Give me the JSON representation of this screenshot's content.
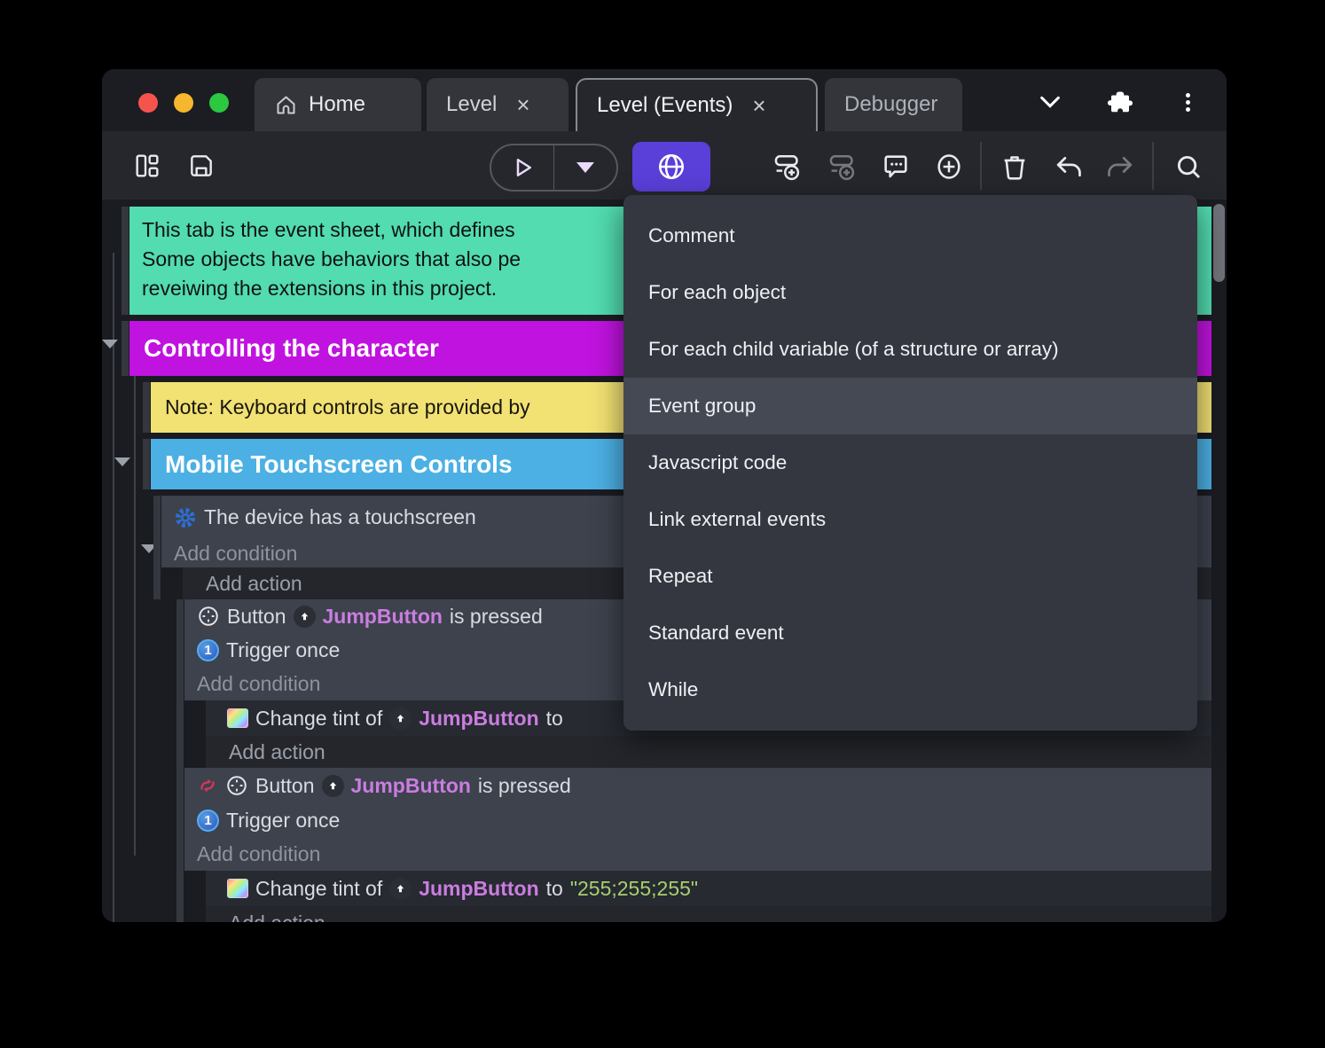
{
  "colors": {
    "accent_purple": "#5b3fd9",
    "comment_teal": "#52dcb0",
    "group_magenta": "#c013df",
    "note_yellow": "#f2e173",
    "group_blue": "#4cb0e4",
    "object_purple": "#cb7de0",
    "string_green": "#a8cf70"
  },
  "titlebar": {
    "tabs": [
      {
        "label": "Home"
      },
      {
        "label": "Level",
        "close_glyph": "×"
      },
      {
        "label": "Level (Events)",
        "close_glyph": "×"
      },
      {
        "label": "Debugger"
      }
    ]
  },
  "menu": {
    "highlighted": "Event group",
    "items": [
      "Comment",
      "For each object",
      "For each child variable (of a structure or array)",
      "Event group",
      "Javascript code",
      "Link external events",
      "Repeat",
      "Standard event",
      "While"
    ]
  },
  "sheet": {
    "comment": {
      "line1": "This tab is the event sheet, which defines",
      "line2": "Some objects have behaviors that also pe",
      "line3": "reveiwing the extensions in this project."
    },
    "group_character": "Controlling the character",
    "note": "Note: Keyboard controls are provided by",
    "group_touch": "Mobile Touchscreen Controls",
    "labels": {
      "add_condition": "Add condition",
      "add_action": "Add action"
    },
    "block1": {
      "condition": "The device has a touchscreen"
    },
    "block2": {
      "plugin": "Button",
      "object": "JumpButton",
      "predicate": "is pressed",
      "trigger": "Trigger once",
      "trigger_digit": "1",
      "action_verb": "Change tint of",
      "action_object": "JumpButton",
      "action_to": "to"
    },
    "block3": {
      "plugin": "Button",
      "object": "JumpButton",
      "predicate": "is pressed",
      "trigger": "Trigger once",
      "trigger_digit": "1",
      "action_verb": "Change tint of",
      "action_object": "JumpButton",
      "action_to": "to",
      "action_value": "\"255;255;255\""
    }
  }
}
